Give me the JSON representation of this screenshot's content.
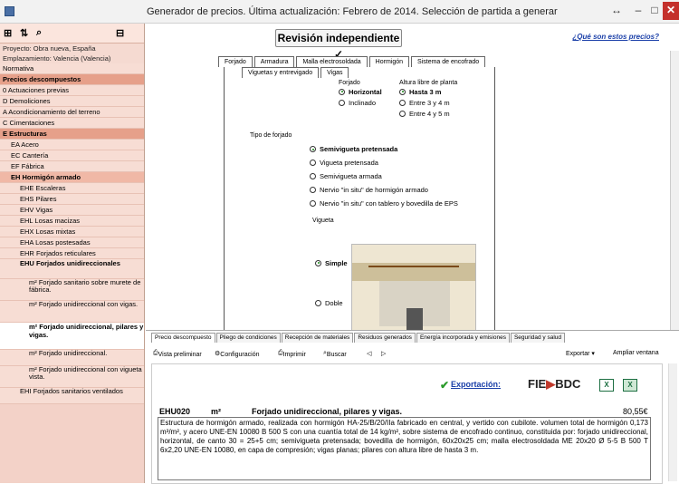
{
  "window": {
    "title": "Generador de precios. Última actualización: Febrero de 2014. Selección de partida a generar",
    "btn_restore": "↔",
    "btn_min": "–",
    "btn_max": "□",
    "btn_close": "✕"
  },
  "sidebar": {
    "toolbar": {
      "icon1": "⊞",
      "icon2": "⇅",
      "icon3": "⌕",
      "icon4": "⊟"
    },
    "info": [
      "Proyecto: Obra nueva, España",
      "Emplazamiento: Valencia (Valencia)"
    ],
    "items": [
      {
        "code": "",
        "label": "Normativa"
      },
      {
        "code": "",
        "label": "Precios descompuestos"
      },
      {
        "code": "0",
        "label": "Actuaciones previas"
      },
      {
        "code": "D",
        "label": "Demoliciones"
      },
      {
        "code": "A",
        "label": "Acondicionamiento del terreno"
      },
      {
        "code": "C",
        "label": "Cimentaciones"
      },
      {
        "code": "E",
        "label": "Estructuras"
      },
      {
        "code": "EA",
        "label": "Acero"
      },
      {
        "code": "EC",
        "label": "Cantería"
      },
      {
        "code": "EF",
        "label": "Fábrica"
      },
      {
        "code": "EH",
        "label": "Hormigón armado"
      },
      {
        "code": "EHE",
        "label": "Escaleras"
      },
      {
        "code": "EHS",
        "label": "Pilares"
      },
      {
        "code": "EHV",
        "label": "Vigas"
      },
      {
        "code": "EHL",
        "label": "Losas macizas"
      },
      {
        "code": "EHX",
        "label": "Losas mixtas"
      },
      {
        "code": "EHA",
        "label": "Losas postesadas"
      },
      {
        "code": "EHR",
        "label": "Forjados reticulares"
      },
      {
        "code": "EHU",
        "label": "Forjados unidireccionales"
      },
      {
        "code": "m²",
        "label": "Forjado sanitario sobre murete de fábrica."
      },
      {
        "code": "m²",
        "label": "Forjado unidireccional con vigas."
      },
      {
        "code": "m²",
        "label": "Forjado unidireccional, pilares y vigas."
      },
      {
        "code": "m²",
        "label": "Forjado unidireccional."
      },
      {
        "code": "m²",
        "label": "Forjado unidireccional con vigueta vista."
      },
      {
        "code": "EHI",
        "label": "Forjados sanitarios ventilados"
      }
    ]
  },
  "main": {
    "review_button": "Revisión independiente ✓",
    "prices_link": "¿Qué son estos precios?",
    "tabs": [
      "Forjado",
      "Armadura",
      "Malla electrosoldada",
      "Hormigón",
      "Sistema de encofrado"
    ],
    "subtabs": [
      "Viguetas y entrevigado",
      "Vigas"
    ],
    "forjado": {
      "title": "Forjado",
      "options": [
        "Horizontal",
        "Inclinado"
      ],
      "selected": 0
    },
    "altura": {
      "title": "Altura libre de planta",
      "options": [
        "Hasta 3 m",
        "Entre 3 y 4 m",
        "Entre 4 y 5 m"
      ],
      "selected": 0
    },
    "tipo": {
      "title": "Tipo de forjado",
      "options": [
        "Semivigueta pretensada",
        "Vigueta pretensada",
        "Semivigueta armada",
        "Nervio \"in situ\" de hormigón armado",
        "Nervio \"in situ\" con tablero y bovedilla de EPS"
      ],
      "selected": 0
    },
    "vigueta": {
      "title": "Vigueta",
      "options": [
        "Simple",
        "Doble"
      ],
      "selected": 0
    }
  },
  "bottom": {
    "tabs": [
      "Precio descompuesto",
      "Pliego de condiciones",
      "Recepción de materiales",
      "Residuos generados",
      "Energía incorporada y emisiones",
      "Seguridad y salud"
    ],
    "toolbar": {
      "preview": "Vista preliminar",
      "config": "Configuración",
      "print": "Imprimir",
      "search": "Buscar",
      "prev": "◁",
      "next": "▷",
      "export": "Exportar ▾",
      "expand": "Ampliar ventana"
    },
    "export_label": "Exportación:",
    "fie_logo": "FIE",
    "bdc_logo": "BDC",
    "item": {
      "code": "EHU020",
      "unit": "m²",
      "title": "Forjado unidireccional, pilares y vigas.",
      "price": "80,55€"
    },
    "description": "Estructura de hormigón armado, realizada con hormigón HA-25/B/20/IIa fabricado en central, y vertido con cubilote. volumen total de hormigón 0,173 m³/m², y acero UNE-EN 10080 B 500 S con una cuantía total de 14 kg/m², sobre sistema de encofrado continuo, constituida por: forjado unidireccional, horizontal, de canto 30 = 25+5 cm; semivigueta pretensada; bovedilla de hormigón, 60x20x25 cm; malla electrosoldada ME 20x20 Ø 5-5 B 500 T 6x2,20 UNE-EN 10080, en capa de compresión; vigas planas; pilares con altura libre de hasta 3 m."
  }
}
